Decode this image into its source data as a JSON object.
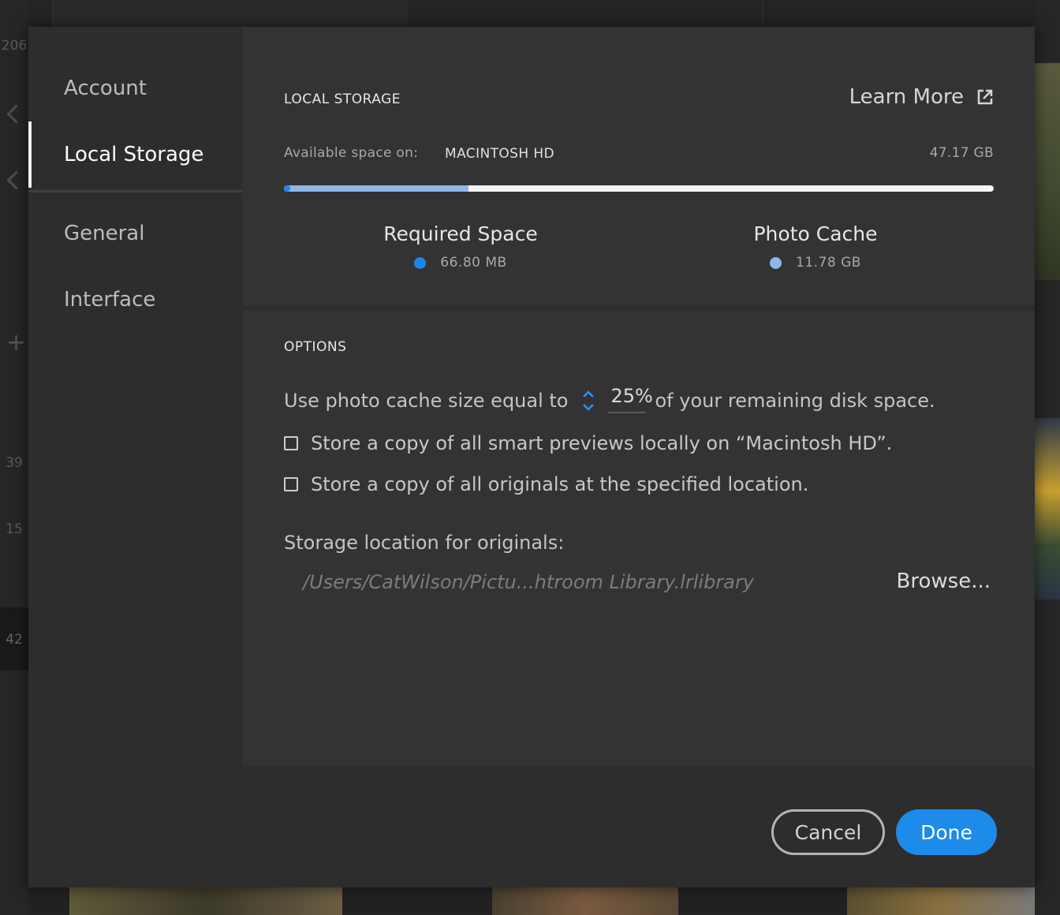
{
  "background": {
    "side_numbers": [
      "206",
      "39",
      "15",
      "42"
    ]
  },
  "sidebar": {
    "items": [
      {
        "label": "Account",
        "active": false
      },
      {
        "label": "Local Storage",
        "active": true
      },
      {
        "label": "General",
        "active": false
      },
      {
        "label": "Interface",
        "active": false
      }
    ]
  },
  "storage": {
    "title": "LOCAL STORAGE",
    "learn_more": "Learn More",
    "available_label": "Available space on:",
    "drive_name": "MACINTOSH HD",
    "available_size": "47.17 GB",
    "usage_fraction": {
      "required": 0.005,
      "photo_cache": 0.26
    },
    "legend": [
      {
        "title": "Required Space",
        "value": "66.80 MB",
        "color": "#1f86e8"
      },
      {
        "title": "Photo Cache",
        "value": "11.78 GB",
        "color": "#8fb8e6"
      }
    ]
  },
  "options": {
    "title": "OPTIONS",
    "cache_prefix": "Use photo cache size equal to",
    "cache_value": "25%",
    "cache_suffix": "of your remaining disk space.",
    "checkbox_smart_previews": {
      "label": "Store a copy of all smart previews locally on “Macintosh HD”.",
      "checked": false
    },
    "checkbox_originals": {
      "label": "Store a copy of all originals at the specified location.",
      "checked": false
    },
    "location_label": "Storage location for originals:",
    "location_path": "/Users/CatWilson/Pictu...htroom Library.lrlibrary",
    "browse_label": "Browse..."
  },
  "footer": {
    "cancel_label": "Cancel",
    "done_label": "Done"
  },
  "colors": {
    "accent": "#1d8bea",
    "dialog_bg": "#2d2d2d",
    "panel_bg": "#333333"
  }
}
